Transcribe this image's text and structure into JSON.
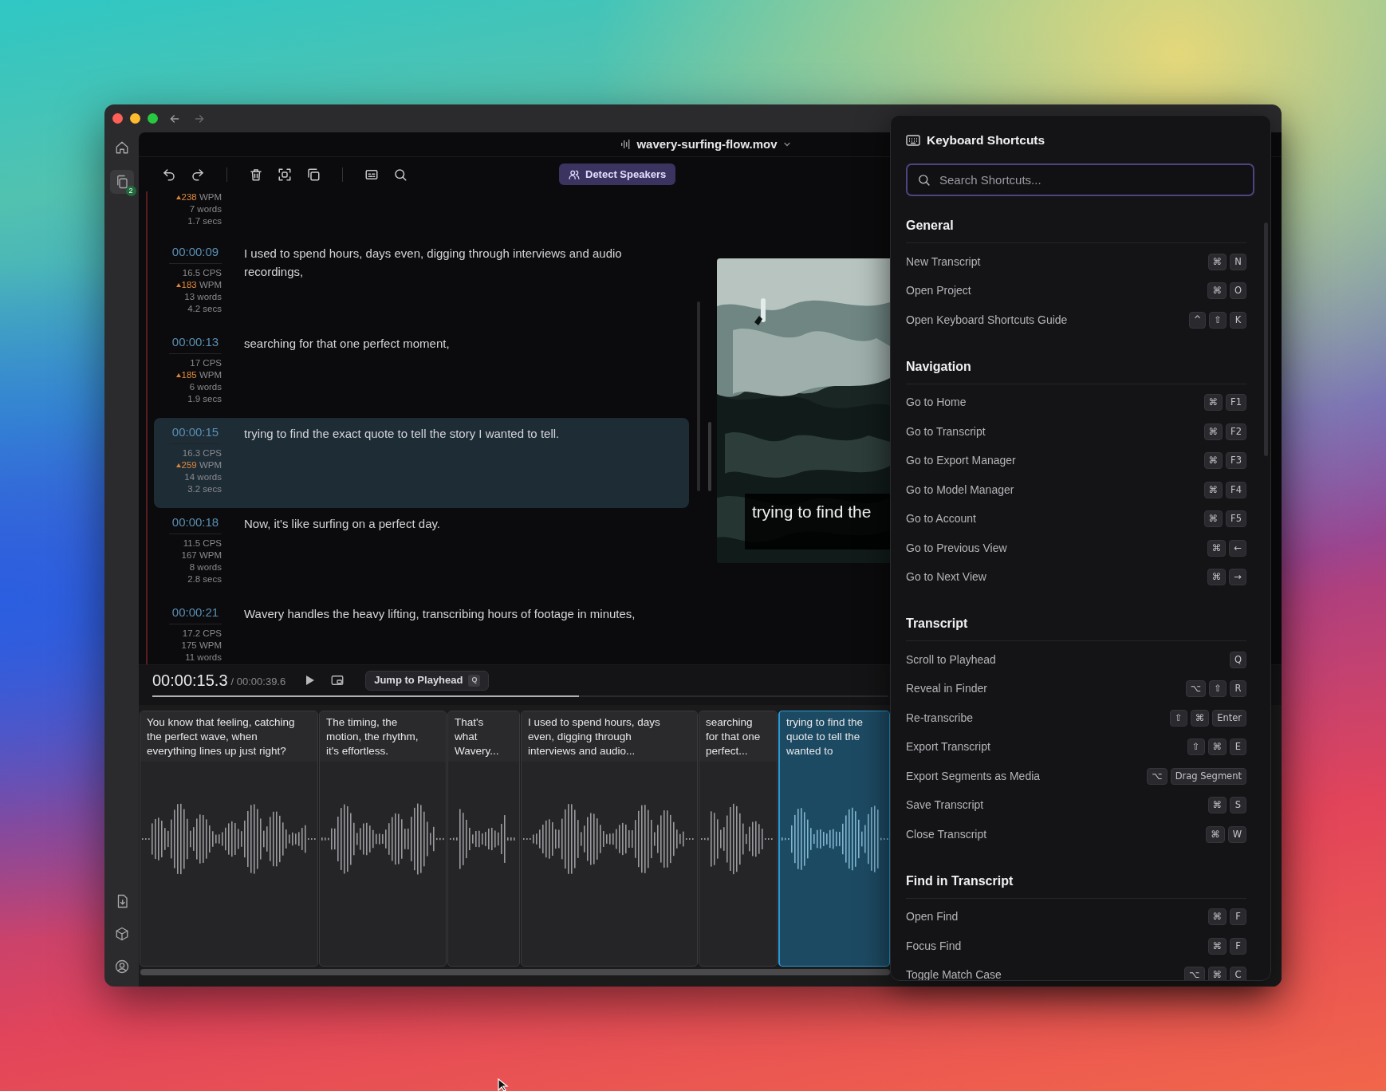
{
  "file_title": "wavery-surfing-flow.mov",
  "sidebar": {
    "items": [
      {
        "kind": "home",
        "selected": false
      },
      {
        "kind": "transcripts",
        "selected": true,
        "badge": "2"
      }
    ],
    "bottom_items": [
      {
        "kind": "export"
      },
      {
        "kind": "models"
      },
      {
        "kind": "account"
      }
    ]
  },
  "toolbar": {
    "detect_speakers": "Detect Speakers"
  },
  "segments": [
    {
      "stats": [
        {
          "value": "238",
          "unit": "WPM",
          "warn": true
        },
        {
          "value": "7",
          "unit": "words",
          "warn": false
        },
        {
          "value": "1.7",
          "unit": "secs",
          "warn": false
        }
      ],
      "selected": false
    },
    {
      "time": "00:00:09",
      "text": "I used to spend hours, days even, digging through interviews and audio recordings,",
      "stats": [
        {
          "value": "16.5",
          "unit": "CPS",
          "warn": false
        },
        {
          "value": "183",
          "unit": "WPM",
          "warn": true
        },
        {
          "value": "13",
          "unit": "words",
          "warn": false
        },
        {
          "value": "4.2",
          "unit": "secs",
          "warn": false
        }
      ],
      "selected": false
    },
    {
      "time": "00:00:13",
      "text": "searching for that one perfect moment,",
      "stats": [
        {
          "value": "17",
          "unit": "CPS",
          "warn": false
        },
        {
          "value": "185",
          "unit": "WPM",
          "warn": true
        },
        {
          "value": "6",
          "unit": "words",
          "warn": false
        },
        {
          "value": "1.9",
          "unit": "secs",
          "warn": false
        }
      ],
      "selected": false
    },
    {
      "time": "00:00:15",
      "text": "trying to find the exact quote to tell the story I wanted to tell.",
      "stats": [
        {
          "value": "16.3",
          "unit": "CPS",
          "warn": false
        },
        {
          "value": "259",
          "unit": "WPM",
          "warn": true
        },
        {
          "value": "14",
          "unit": "words",
          "warn": false
        },
        {
          "value": "3.2",
          "unit": "secs",
          "warn": false
        }
      ],
      "selected": true
    },
    {
      "time": "00:00:18",
      "text": "Now, it's like surfing on a perfect day.",
      "stats": [
        {
          "value": "11.5",
          "unit": "CPS",
          "warn": false
        },
        {
          "value": "167",
          "unit": "WPM",
          "warn": false
        },
        {
          "value": "8",
          "unit": "words",
          "warn": false
        },
        {
          "value": "2.8",
          "unit": "secs",
          "warn": false
        }
      ],
      "selected": false
    },
    {
      "time": "00:00:21",
      "text": "Wavery handles the heavy lifting, transcribing hours of footage in minutes,",
      "stats": [
        {
          "value": "17.2",
          "unit": "CPS",
          "warn": false
        },
        {
          "value": "175",
          "unit": "WPM",
          "warn": false
        },
        {
          "value": "11",
          "unit": "words",
          "warn": false
        }
      ],
      "selected": false
    }
  ],
  "preview": {
    "kind": "picture",
    "caption": "trying to find the"
  },
  "player": {
    "current_time": "00:00:15.3",
    "duration": "/ 00:00:39.6",
    "jump_button": "Jump to Playhead",
    "jump_key": "Q",
    "level": 0.58
  },
  "timeline": {
    "clips": [
      {
        "text": "You know that feeling, catching\nthe perfect wave, when\neverything lines up just right?",
        "selected": false
      },
      {
        "text": "The timing, the\nmotion, the rhythm,\nit's effortless.",
        "selected": false
      },
      {
        "text": "That's\nwhat\nWavery...",
        "selected": false
      },
      {
        "text": "I used to spend hours, days\neven, digging through\ninterviews and audio...",
        "selected": false
      },
      {
        "text": "searching\nfor that one\nperfect...",
        "selected": false
      },
      {
        "text": "trying to find the\nquote to tell the\nwanted to",
        "selected": true
      }
    ]
  },
  "shortcuts": {
    "title": "Keyboard Shortcuts",
    "search_placeholder": "Search Shortcuts...",
    "sections": [
      {
        "title": "General",
        "items": [
          {
            "label": "New Transcript",
            "keys": [
              "⌘",
              "N"
            ]
          },
          {
            "label": "Open Project",
            "keys": [
              "⌘",
              "O"
            ]
          },
          {
            "label": "Open Keyboard Shortcuts Guide",
            "keys": [
              "^",
              "⇧",
              "K"
            ]
          }
        ]
      },
      {
        "title": "Navigation",
        "items": [
          {
            "label": "Go to Home",
            "keys": [
              "⌘",
              "F1"
            ]
          },
          {
            "label": "Go to Transcript",
            "keys": [
              "⌘",
              "F2"
            ]
          },
          {
            "label": "Go to Export Manager",
            "keys": [
              "⌘",
              "F3"
            ]
          },
          {
            "label": "Go to Model Manager",
            "keys": [
              "⌘",
              "F4"
            ]
          },
          {
            "label": "Go to Account",
            "keys": [
              "⌘",
              "F5"
            ]
          },
          {
            "label": "Go to Previous View",
            "keys": [
              "⌘",
              "←"
            ]
          },
          {
            "label": "Go to Next View",
            "keys": [
              "⌘",
              "→"
            ]
          }
        ]
      },
      {
        "title": "Transcript",
        "items": [
          {
            "label": "Scroll to Playhead",
            "keys": [
              "Q"
            ]
          },
          {
            "label": "Reveal in Finder",
            "keys": [
              "⌥",
              "⇧",
              "R"
            ]
          },
          {
            "label": "Re-transcribe",
            "keys": [
              "⇧",
              "⌘",
              "Enter"
            ]
          },
          {
            "label": "Export Transcript",
            "keys": [
              "⇧",
              "⌘",
              "E"
            ]
          },
          {
            "label": "Export Segments as Media",
            "keys": [
              "⌥",
              "Drag Segment"
            ]
          },
          {
            "label": "Save Transcript",
            "keys": [
              "⌘",
              "S"
            ]
          },
          {
            "label": "Close Transcript",
            "keys": [
              "⌘",
              "W"
            ]
          }
        ]
      },
      {
        "title": "Find in Transcript",
        "items": [
          {
            "label": "Open Find",
            "keys": [
              "⌘",
              "F"
            ]
          },
          {
            "label": "Focus Find",
            "keys": [
              "⌘",
              "F"
            ]
          },
          {
            "label": "Toggle Match Case",
            "keys": [
              "⌥",
              "⌘",
              "C"
            ]
          }
        ]
      }
    ]
  }
}
